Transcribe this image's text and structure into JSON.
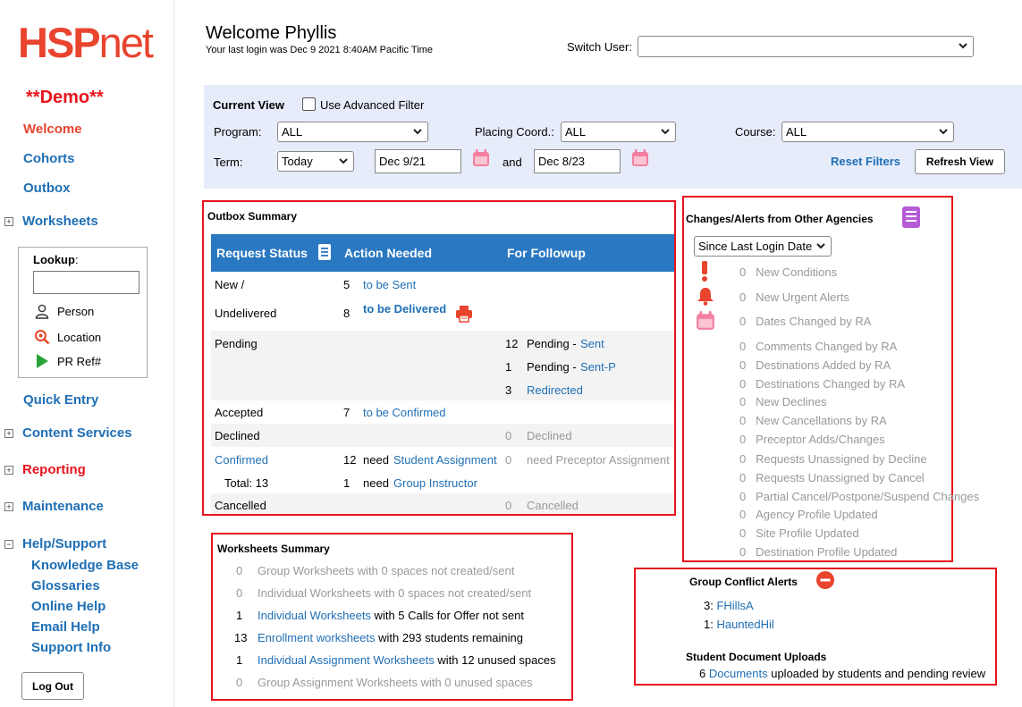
{
  "sidebar": {
    "logo_a": "HSP",
    "logo_b": "net",
    "demo": "**Demo**",
    "nav": {
      "welcome": "Welcome",
      "cohorts": "Cohorts",
      "outbox": "Outbox",
      "worksheets": "Worksheets",
      "quick_entry": "Quick Entry",
      "content_services": "Content Services",
      "reporting": "Reporting",
      "maintenance": "Maintenance",
      "help_support": "Help/Support"
    },
    "help_items": [
      "Knowledge Base",
      "Glossaries",
      "Online Help",
      "Email Help",
      "Support Info"
    ],
    "lookup": {
      "label": "Lookup",
      "colon": ":",
      "items": [
        "Person",
        "Location",
        "PR Ref#"
      ],
      "input_value": ""
    },
    "logout": "Log Out"
  },
  "header": {
    "welcome": "Welcome Phyllis",
    "last_login": "Your last login was Dec 9 2021 8:40AM Pacific Time",
    "switch_user_label": "Switch User:",
    "switch_user_value": ""
  },
  "filter": {
    "current_view": "Current View",
    "advanced": "Use Advanced Filter",
    "program_label": "Program:",
    "program_value": "ALL",
    "placing_label": "Placing Coord.:",
    "placing_value": "ALL",
    "course_label": "Course:",
    "course_value": "ALL",
    "term_label": "Term:",
    "term_value": "Today",
    "from_date": "Dec 9/21",
    "and": "and",
    "to_date": "Dec 8/23",
    "reset": "Reset Filters",
    "refresh": "Refresh View"
  },
  "outbox": {
    "title": "Outbox Summary",
    "headers": {
      "status": "Request Status",
      "action": "Action Needed",
      "followup": "For Followup"
    },
    "new": {
      "status_a": "New /",
      "status_b": "Undelivered",
      "n1": "5",
      "l1": "to be Sent",
      "n2": "8",
      "l2": "to be Delivered"
    },
    "pending": {
      "status": "Pending",
      "rows": [
        {
          "n": "12",
          "prefix": "Pending - ",
          "link": "Sent"
        },
        {
          "n": "1",
          "prefix": "Pending - ",
          "link": "Sent-P"
        },
        {
          "n": "3",
          "prefix": "",
          "link": "Redirected"
        }
      ]
    },
    "accepted": {
      "status": "Accepted",
      "n": "7",
      "link": "to be Confirmed"
    },
    "declined": {
      "status": "Declined",
      "n": "0",
      "text": "Declined"
    },
    "confirmed": {
      "status": "Confirmed",
      "total": "Total: 13",
      "n1": "12",
      "need1": "need",
      "link1": "Student Assignment",
      "f_n": "0",
      "f_text": "need Preceptor Assignment",
      "n2": "1",
      "need2": "need",
      "link2": "Group Instructor"
    },
    "cancelled": {
      "status": "Cancelled",
      "n": "0",
      "text": "Cancelled"
    }
  },
  "changes": {
    "title": "Changes/Alerts from Other Agencies",
    "since_value": "Since Last Login Date",
    "items": [
      {
        "n": "0",
        "label": "New Conditions"
      },
      {
        "n": "0",
        "label": "New Urgent Alerts"
      },
      {
        "n": "0",
        "label": "Dates Changed by RA"
      },
      {
        "n": "0",
        "label": "Comments Changed by RA"
      },
      {
        "n": "0",
        "label": "Destinations Added by RA"
      },
      {
        "n": "0",
        "label": "Destinations Changed by RA"
      },
      {
        "n": "0",
        "label": "New Declines"
      },
      {
        "n": "0",
        "label": "New Cancellations by RA"
      },
      {
        "n": "0",
        "label": "Preceptor Adds/Changes"
      },
      {
        "n": "0",
        "label": "Requests Unassigned by Decline"
      },
      {
        "n": "0",
        "label": "Requests Unassigned by Cancel"
      },
      {
        "n": "0",
        "label": "Partial Cancel/Postpone/Suspend Changes"
      },
      {
        "n": "0",
        "label": "Agency Profile Updated"
      },
      {
        "n": "0",
        "label": "Site Profile Updated"
      },
      {
        "n": "0",
        "label": "Destination Profile Updated"
      }
    ]
  },
  "worksheets": {
    "title": "Worksheets Summary",
    "rows": [
      {
        "n": "0",
        "link": "",
        "text": "Group Worksheets with 0 spaces not created/sent",
        "grey": true
      },
      {
        "n": "0",
        "link": "",
        "text": "Individual Worksheets with 0 spaces not created/sent",
        "grey": true
      },
      {
        "n": "1",
        "link": "Individual Worksheets",
        "text": " with 5 Calls for Offer not sent",
        "grey": false
      },
      {
        "n": "13",
        "link": "Enrollment worksheets",
        "text": " with 293 students remaining",
        "grey": false
      },
      {
        "n": "1",
        "link": "Individual Assignment Worksheets",
        "text": " with 12 unused spaces",
        "grey": false
      },
      {
        "n": "0",
        "link": "",
        "text": "Group Assignment Worksheets with 0 unused spaces",
        "grey": true
      }
    ]
  },
  "group_conflict": {
    "title": "Group Conflict Alerts",
    "items": [
      {
        "n": "3:",
        "link": "FHillsA"
      },
      {
        "n": "1:",
        "link": "HauntedHil"
      }
    ],
    "uploads_title": "Student Document Uploads",
    "uploads_n": "6",
    "uploads_link": "Documents",
    "uploads_text": " uploaded by students and pending review"
  }
}
